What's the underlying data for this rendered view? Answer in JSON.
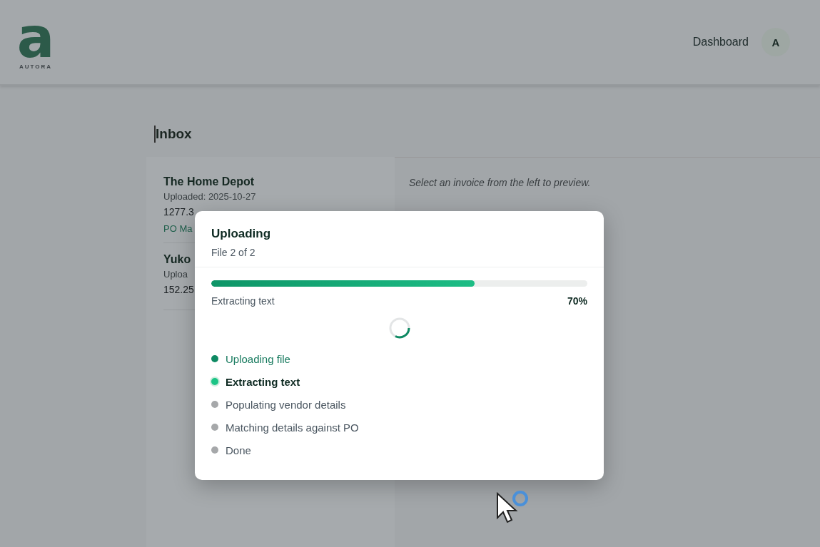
{
  "header": {
    "logo": {
      "mark": "a",
      "wordmark": "AUTORA"
    },
    "nav": "Dashboard",
    "avatar": "A"
  },
  "inbox": {
    "title": "Inbox",
    "items": [
      {
        "vendor": "The Home Depot",
        "uploaded": "Uploaded: 2025-10-27",
        "amount": "1277.3",
        "status": "PO Ma"
      },
      {
        "vendor": "Yuko",
        "uploaded": "Uploa",
        "amount": "152.25"
      }
    ],
    "preview_hint": "Select an invoice from the left to preview."
  },
  "dialog": {
    "title": "Uploading",
    "subtitle": "File 2 of 2",
    "progress": {
      "level": 0.7,
      "label": "Extracting text",
      "percent": "70%"
    },
    "steps": [
      {
        "label": "Uploading file",
        "kind": "done"
      },
      {
        "label": "Extracting text",
        "kind": "active"
      },
      {
        "label": "Populating vendor details",
        "kind": "pending"
      },
      {
        "label": "Matching details against PO",
        "kind": "pending"
      },
      {
        "label": "Done",
        "kind": "pending"
      }
    ]
  }
}
